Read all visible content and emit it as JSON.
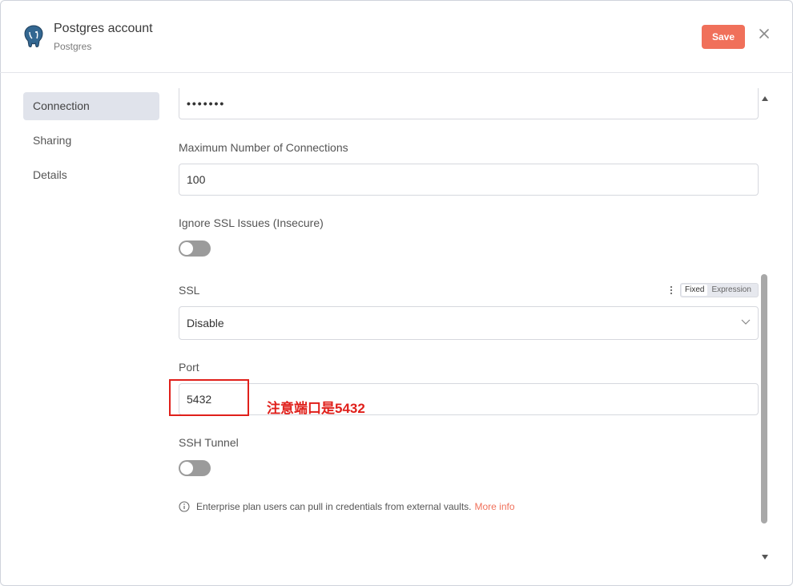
{
  "header": {
    "title": "Postgres account",
    "subtitle": "Postgres",
    "save_label": "Save"
  },
  "sidebar": {
    "items": [
      {
        "label": "Connection",
        "active": true
      },
      {
        "label": "Sharing",
        "active": false
      },
      {
        "label": "Details",
        "active": false
      }
    ]
  },
  "form": {
    "password_value": "•••••••",
    "max_connections": {
      "label": "Maximum Number of Connections",
      "value": "100"
    },
    "ignore_ssl": {
      "label": "Ignore SSL Issues (Insecure)",
      "on": false
    },
    "ssl": {
      "label": "SSL",
      "value": "Disable",
      "mode_fixed": "Fixed",
      "mode_expression": "Expression"
    },
    "port": {
      "label": "Port",
      "value": "5432"
    },
    "ssh_tunnel": {
      "label": "SSH Tunnel",
      "on": false
    },
    "info_text": "Enterprise plan users can pull in credentials from external vaults.",
    "info_link": "More info"
  },
  "annotation": {
    "text": "注意端口是5432",
    "color": "#e0201b"
  },
  "colors": {
    "accent": "#f0705a",
    "active_bg": "#e0e3eb"
  }
}
